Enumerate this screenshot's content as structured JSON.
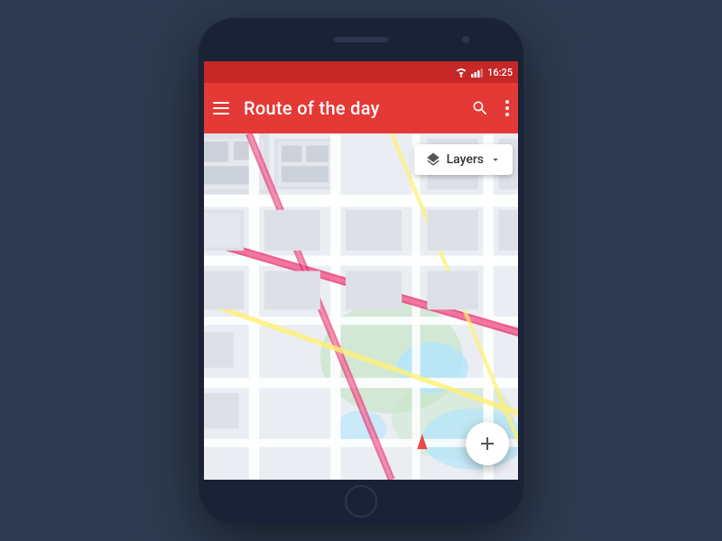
{
  "status_bar": {
    "time": "16:25"
  },
  "app_bar": {
    "title": "Route of the day",
    "menu_icon": "hamburger-menu",
    "search_icon": "search",
    "more_icon": "more-vertical"
  },
  "map": {
    "layers_button_label": "Layers",
    "layers_dropdown_icon": "chevron-down",
    "fab_icon": "plus",
    "fab_label": "+"
  }
}
